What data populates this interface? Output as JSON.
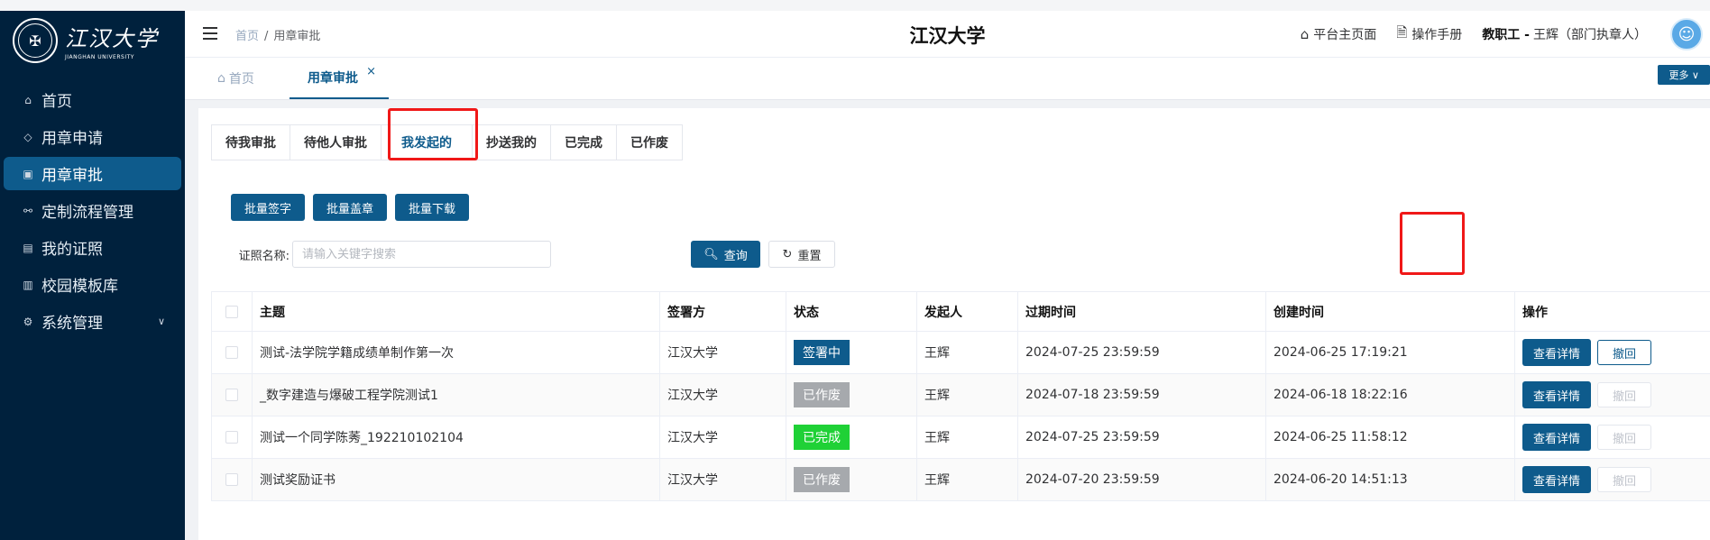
{
  "colors": {
    "primary": "#0e5b8c",
    "sidebar_bg": "#00213d",
    "highlight": "#f01818"
  },
  "sidebar": {
    "logo_text": "江汉大学",
    "logo_sub": "JIANGHAN UNIVERSITY",
    "items": [
      {
        "label": "首页",
        "icon": "home-icon"
      },
      {
        "label": "用章申请",
        "icon": "apply-icon"
      },
      {
        "label": "用章审批",
        "icon": "approve-icon",
        "active": true
      },
      {
        "label": "定制流程管理",
        "icon": "flow-icon"
      },
      {
        "label": "我的证照",
        "icon": "license-icon"
      },
      {
        "label": "校园模板库",
        "icon": "template-icon"
      },
      {
        "label": "系统管理",
        "icon": "settings-icon",
        "has_children": true
      }
    ]
  },
  "header": {
    "breadcrumb": {
      "home": "首页",
      "current": "用章审批"
    },
    "title": "江汉大学",
    "links": {
      "platform": "平台主页面",
      "manual": "操作手册"
    },
    "user_role": "教职工 -",
    "user_name": "王辉（部门执章人）"
  },
  "tabs": {
    "home": "首页",
    "current": "用章审批",
    "close": "×",
    "more": "更多 ∨"
  },
  "status_tabs": [
    "待我审批",
    "待他人审批",
    "我发起的",
    "抄送我的",
    "已完成",
    "已作废"
  ],
  "active_status_tab": 2,
  "batch": {
    "sign": "批量签字",
    "stamp": "批量盖章",
    "download": "批量下载"
  },
  "search": {
    "label": "证照名称:",
    "placeholder": "请输入关键字搜索",
    "query": "查询",
    "reset": "重置"
  },
  "table": {
    "columns": [
      "主题",
      "签署方",
      "状态",
      "发起人",
      "过期时间",
      "创建时间",
      "操作"
    ],
    "detail_label": "查看详情",
    "revoke_label": "撤回",
    "rows": [
      {
        "subject": "测试-法学院学籍成绩单制作第一次",
        "party": "江汉大学",
        "status": "签署中",
        "status_color": "#0e5b8c",
        "initiator": "王辉",
        "expire": "2024-07-25 23:59:59",
        "created": "2024-06-25 17:19:21",
        "revoke_enabled": true
      },
      {
        "subject": "_数字建造与爆破工程学院测试1",
        "party": "江汉大学",
        "status": "已作废",
        "status_color": "#a6a9ad",
        "initiator": "王辉",
        "expire": "2024-07-18 23:59:59",
        "created": "2024-06-18 18:22:16",
        "revoke_enabled": false
      },
      {
        "subject": "测试一个同学陈莠_192210102104",
        "party": "江汉大学",
        "status": "已完成",
        "status_color": "#1fd136",
        "initiator": "王辉",
        "expire": "2024-07-25 23:59:59",
        "created": "2024-06-25 11:58:12",
        "revoke_enabled": false
      },
      {
        "subject": "测试奖励证书",
        "party": "江汉大学",
        "status": "已作废",
        "status_color": "#a6a9ad",
        "initiator": "王辉",
        "expire": "2024-07-20 23:59:59",
        "created": "2024-06-20 14:51:13",
        "revoke_enabled": false
      }
    ]
  }
}
